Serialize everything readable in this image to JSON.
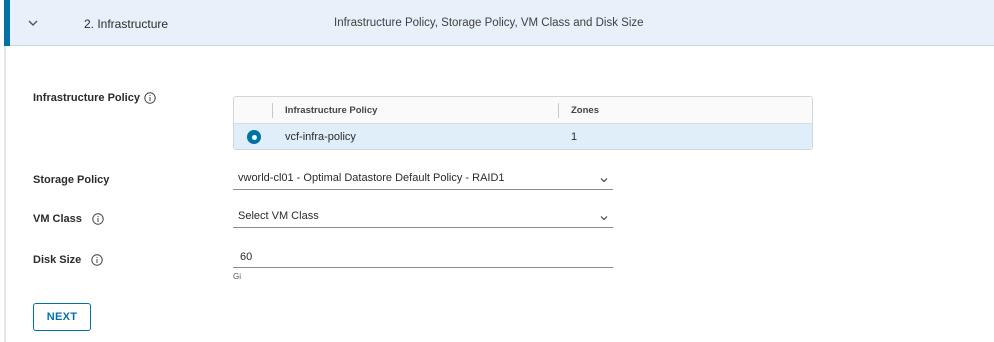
{
  "step": {
    "number_label": "2.  Infrastructure",
    "description": "Infrastructure Policy, Storage Policy, VM Class and Disk Size"
  },
  "fields": {
    "infrastructure_policy_label": "Infrastructure Policy",
    "storage_policy_label": "Storage Policy",
    "vm_class_label": "VM Class",
    "disk_size_label": "Disk Size"
  },
  "policy_grid": {
    "columns": [
      "Infrastructure Policy",
      "Zones"
    ],
    "rows": [
      {
        "policy": "vcf-infra-policy",
        "zones": "1",
        "selected": true
      }
    ]
  },
  "storage_policy": {
    "selected": "vworld-cl01 - Optimal Datastore Default Policy - RAID1"
  },
  "vm_class": {
    "selected": "Select VM Class"
  },
  "disk_size": {
    "value": "60",
    "unit": "Gi"
  },
  "actions": {
    "next_label": "NEXT"
  },
  "colors": {
    "accent": "#0072a3",
    "header_bg": "#e8f1f9",
    "selected_row_bg": "#dfeef8"
  },
  "icons": [
    "chevron-down-icon",
    "info-icon",
    "radio-selected-icon",
    "dropdown-caret-icon"
  ]
}
